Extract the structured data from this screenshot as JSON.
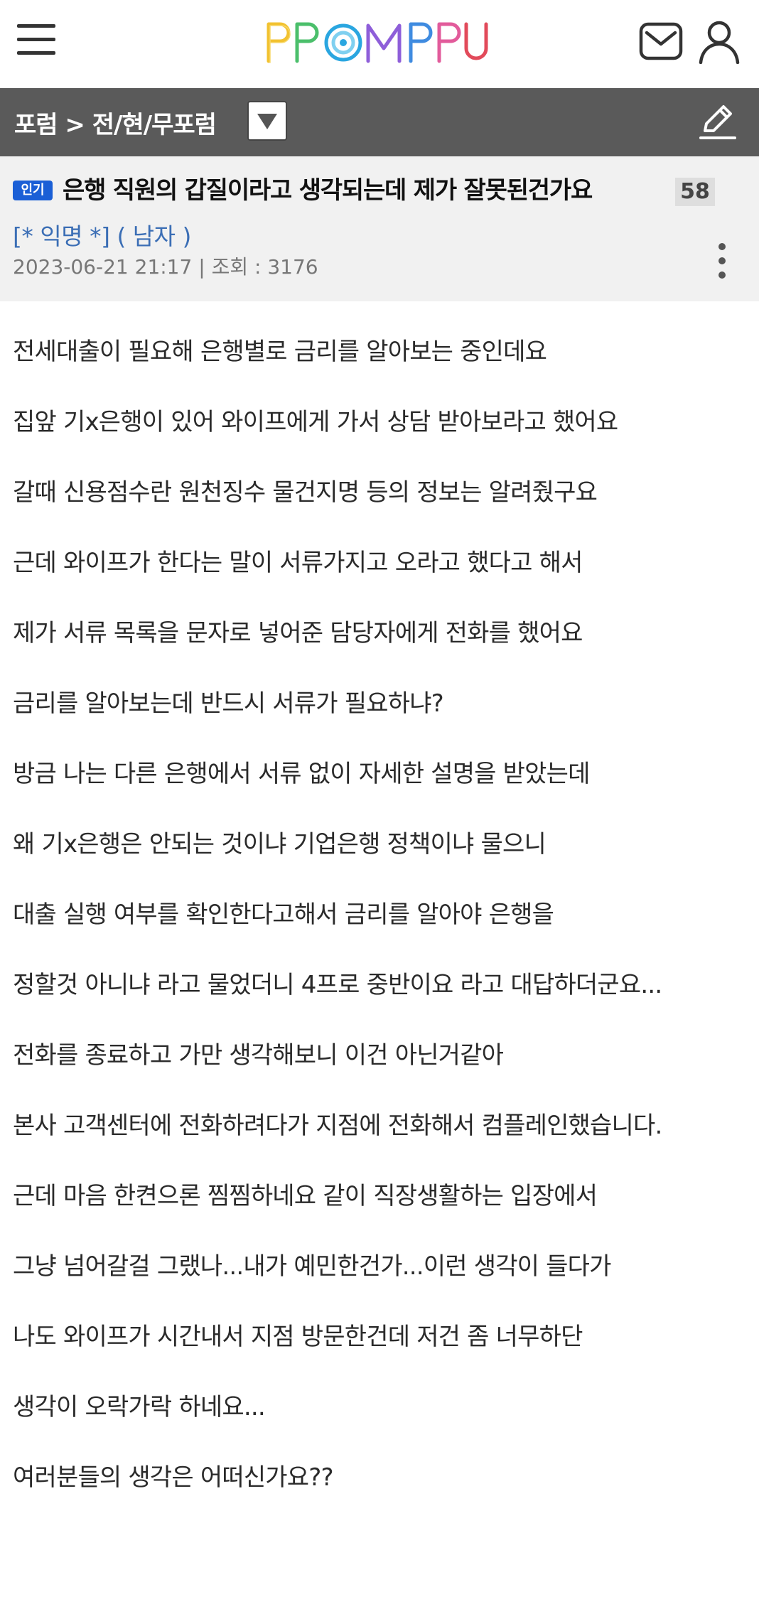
{
  "header": {
    "logo_text": "PPOMPPU",
    "brand_colors": [
      "#f2c230",
      "#4bbf6b",
      "#2aa6e0",
      "#8e5ed9",
      "#e25b9b"
    ]
  },
  "forum": {
    "breadcrumb": "포럼 > 전/현/무포럼",
    "bar_color": "#5a5a5a"
  },
  "post": {
    "badge": "인기",
    "title": "은행 직원의 갑질이라고 생각되는데 제가 잘못된건가요",
    "comment_count": "58",
    "author": "[* 익명 *] ( 남자 )",
    "date": "2023-06-21 21:17",
    "views_label": "조회 : 3176",
    "body": [
      "전세대출이 필요해 은행별로 금리를 알아보는 중인데요",
      "집앞 기x은행이 있어 와이프에게 가서 상담 받아보라고 했어요",
      "갈때 신용점수란 원천징수 물건지명 등의 정보는 알려줬구요",
      "근데 와이프가 한다는 말이 서류가지고 오라고 했다고 해서",
      "제가 서류 목록을 문자로 넣어준 담당자에게 전화를 했어요",
      "금리를 알아보는데 반드시 서류가 필요하냐?",
      "방금 나는 다른 은행에서 서류 없이 자세한 설명을 받았는데",
      "왜 기x은행은 안되는 것이냐 기업은행 정책이냐 물으니",
      "대출 실행 여부를 확인한다고해서 금리를 알아야 은행을",
      "정할것 아니냐 라고 물었더니 4프로 중반이요 라고 대답하더군요...",
      "전화를 종료하고 가만 생각해보니 이건 아닌거같아",
      "본사 고객센터에 전화하려다가 지점에 전화해서 컴플레인했습니다.",
      "근데 마음 한켠으론 찜찜하네요 같이 직장생활하는 입장에서",
      "그냥 넘어갈걸 그랬나...내가 예민한건가...이런 생각이 들다가",
      "나도 와이프가 시간내서 지점 방문한건데 저건 좀 너무하단",
      "생각이 오락가락 하네요...",
      "여러분들의 생각은 어떠신가요??"
    ]
  },
  "colors": {
    "badge": "#1a5fd6",
    "author": "#3b6eb5",
    "post_header_bg": "#f1f1f1"
  },
  "icons": [
    "menu-icon",
    "mail-icon",
    "user-icon",
    "dropdown-arrow-icon",
    "pencil-icon",
    "more-vertical-icon"
  ]
}
